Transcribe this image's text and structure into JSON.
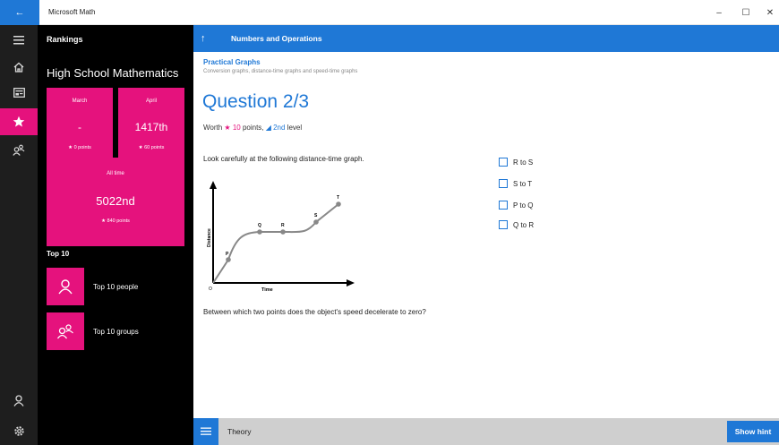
{
  "window": {
    "title": "Microsoft Math",
    "back_icon": "arrow-left-icon",
    "min": "–",
    "max": "☐",
    "close": "✕"
  },
  "colors": {
    "accent": "#1f78d6",
    "pink": "#e5127d",
    "rail": "#1e1e1e",
    "panel": "#000000"
  },
  "rail": {
    "items": [
      "hamburger-icon",
      "home-icon",
      "news-icon",
      "star-icon",
      "groups-icon",
      "person-icon",
      "settings-icon"
    ],
    "active": "star-icon"
  },
  "rankings": {
    "header": "Rankings",
    "subject": "High School Mathematics",
    "march": {
      "label": "March",
      "value": "-",
      "points": "★ 0 points"
    },
    "april": {
      "label": "April",
      "value": "1417th",
      "points": "★ 60 points"
    },
    "all_time": {
      "label": "All time",
      "value": "5022nd",
      "points": "★ 840 points"
    },
    "top10_header": "Top 10",
    "top10_people": "Top 10 people",
    "top10_groups": "Top 10 groups"
  },
  "main": {
    "up_icon": "↑",
    "title": "Numbers and Operations",
    "topic_title": "Practical Graphs",
    "topic_sub": "Conversion graphs, distance-time graphs and speed-time graphs",
    "question_title": "Question 2/3",
    "worth": {
      "prefix": "Worth ",
      "points": "★ 10",
      "mid": " points, ",
      "level": "◢ 2nd",
      "suffix": " level"
    },
    "prompt": "Look carefully at the following distance-time graph.",
    "graph": {
      "ylabel": "Distance",
      "xlabel": "Time",
      "origin": "O",
      "points": [
        "P",
        "Q",
        "R",
        "S",
        "T"
      ]
    },
    "question": "Between which two points does the object's speed decelerate to zero?",
    "options": [
      "R to S",
      "S to T",
      "P to Q",
      "Q to R"
    ]
  },
  "bottom": {
    "theory": "Theory",
    "hint": "Show hint"
  }
}
